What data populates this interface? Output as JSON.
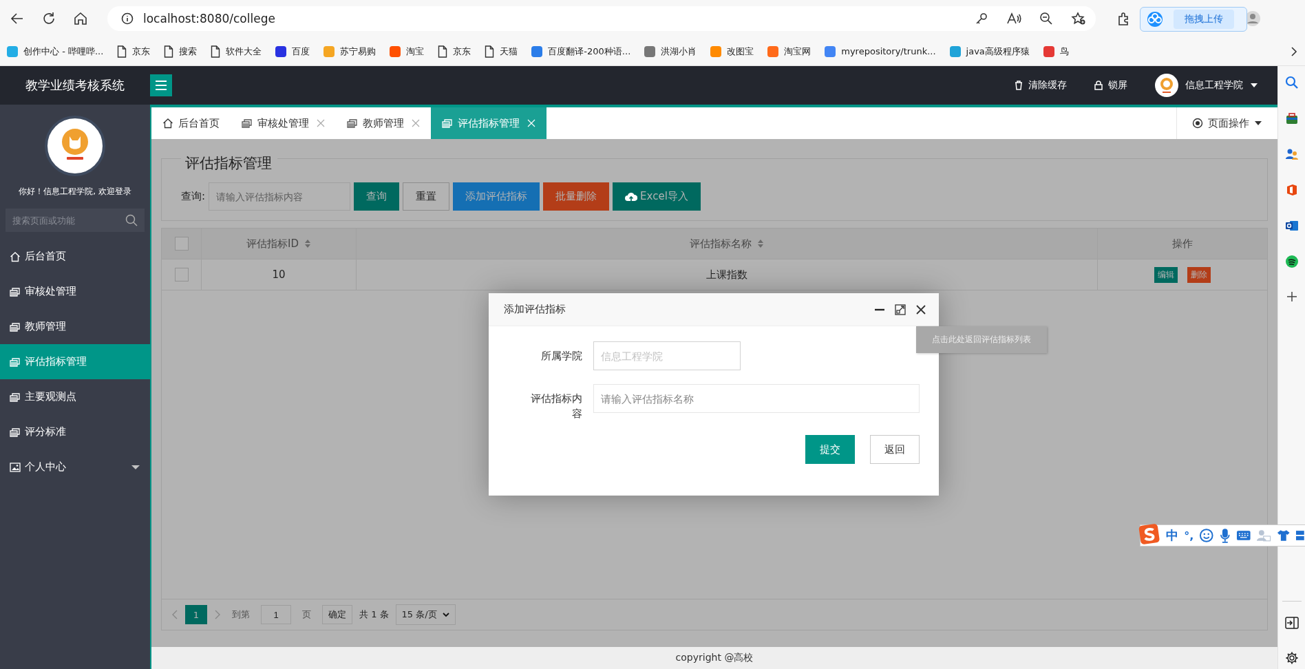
{
  "browser": {
    "address": "localhost:8080/college"
  },
  "bookmarks": [
    {
      "label": "创作中心 - 哔哩哔...",
      "kind": "site",
      "color": "#23ade5"
    },
    {
      "label": "京东",
      "kind": "page"
    },
    {
      "label": "搜索",
      "kind": "page"
    },
    {
      "label": "软件大全",
      "kind": "page"
    },
    {
      "label": "百度",
      "kind": "site",
      "color": "#2932e1"
    },
    {
      "label": "苏宁易购",
      "kind": "site",
      "color": "#f5a623"
    },
    {
      "label": "淘宝",
      "kind": "site",
      "color": "#ff5000"
    },
    {
      "label": "京东",
      "kind": "page"
    },
    {
      "label": "天猫",
      "kind": "page"
    },
    {
      "label": "百度翻译-200种语...",
      "kind": "site",
      "color": "#2b7de9"
    },
    {
      "label": "洪湖小肖",
      "kind": "site",
      "color": "#777777"
    },
    {
      "label": "改图宝",
      "kind": "site",
      "color": "#ff8a00"
    },
    {
      "label": "淘宝网",
      "kind": "site",
      "color": "#ff6a1a"
    },
    {
      "label": "myrepository/trunk...",
      "kind": "site",
      "color": "#4285f4"
    },
    {
      "label": "java高级程序猿",
      "kind": "site",
      "color": "#1fa3d8"
    },
    {
      "label": "鸟",
      "kind": "site",
      "color": "#e53935"
    }
  ],
  "cloud_upload": {
    "label": "拖拽上传"
  },
  "app": {
    "title": "教学业绩考核系统",
    "header_actions": [
      {
        "kind": "trash",
        "label": "清除缓存"
      },
      {
        "kind": "lock",
        "label": "锁屏"
      }
    ],
    "user": "信息工程学院"
  },
  "sidebar": {
    "greeting": "你好！信息工程学院, 欢迎登录",
    "search": {
      "placeholder": "搜索页面或功能"
    },
    "items": [
      {
        "label": "后台首页",
        "kind": "home",
        "selected": false
      },
      {
        "label": "审核处管理",
        "kind": "page",
        "selected": false
      },
      {
        "label": "教师管理",
        "kind": "page",
        "selected": false
      },
      {
        "label": "评估指标管理",
        "kind": "page",
        "selected": true
      },
      {
        "label": "主要观测点",
        "kind": "page",
        "selected": false
      },
      {
        "label": "评分标准",
        "kind": "page",
        "selected": false
      },
      {
        "label": "个人中心",
        "kind": "group",
        "selected": false
      }
    ]
  },
  "tabs": [
    {
      "label": "后台首页",
      "kind": "home",
      "closable": false,
      "selected": false
    },
    {
      "label": "审核处管理",
      "kind": "page",
      "closable": true,
      "selected": false
    },
    {
      "label": "教师管理",
      "kind": "page",
      "closable": true,
      "selected": false
    },
    {
      "label": "评估指标管理",
      "kind": "page",
      "closable": true,
      "selected": true
    }
  ],
  "page_actions": "页面操作",
  "content": {
    "legend": "评估指标管理",
    "query_label": "查询:",
    "query": {
      "placeholder": "请输入评估指标内容"
    },
    "buttons": [
      {
        "label": "查询",
        "kind": "plain",
        "color": "#00695f"
      },
      {
        "label": "重置",
        "kind": "plain",
        "color": "#b3b3b3"
      },
      {
        "label": "添加评估指标",
        "kind": "plain",
        "color": "#156fb3"
      },
      {
        "label": "批量删除",
        "kind": "plain",
        "color": "#b33d18"
      },
      {
        "label": "Excel导入",
        "kind": "upload",
        "color": "#00695f"
      }
    ]
  },
  "table": {
    "header_checked": false,
    "columns": [
      {
        "label": "评估指标ID",
        "sortable": true
      },
      {
        "label": "评估指标名称",
        "sortable": true
      },
      {
        "label": "操作",
        "sortable": false
      }
    ],
    "rows": [
      {
        "checked": false,
        "cells": [
          "10",
          "上课指数"
        ],
        "actions": [
          {
            "label": "编辑",
            "color": "#00695f"
          },
          {
            "label": "删除",
            "color": "#b33d18"
          }
        ]
      }
    ]
  },
  "pager": {
    "pages": [
      {
        "label": "1",
        "selected": true
      }
    ],
    "goto_label": "到第",
    "goto_value": "1",
    "page_unit": "页",
    "confirm": "确定",
    "total": "共 1 条",
    "page_size": "15 条/页"
  },
  "footer": "copyright @高校",
  "dialog": {
    "title": "添加评估指标",
    "fields": [
      {
        "label": "所属学院",
        "placeholder": "信息工程学院",
        "kind": "short"
      },
      {
        "label": "评估指标内容",
        "placeholder": "请输入评估指标名称",
        "kind": "wide"
      }
    ],
    "buttons": [
      {
        "label": "提交",
        "kind": "primary"
      },
      {
        "label": "返回",
        "kind": "default"
      }
    ]
  },
  "tooltip": "点击此处返回评估指标列表",
  "ime": {
    "mode": "中",
    "punctuation": "°,"
  }
}
